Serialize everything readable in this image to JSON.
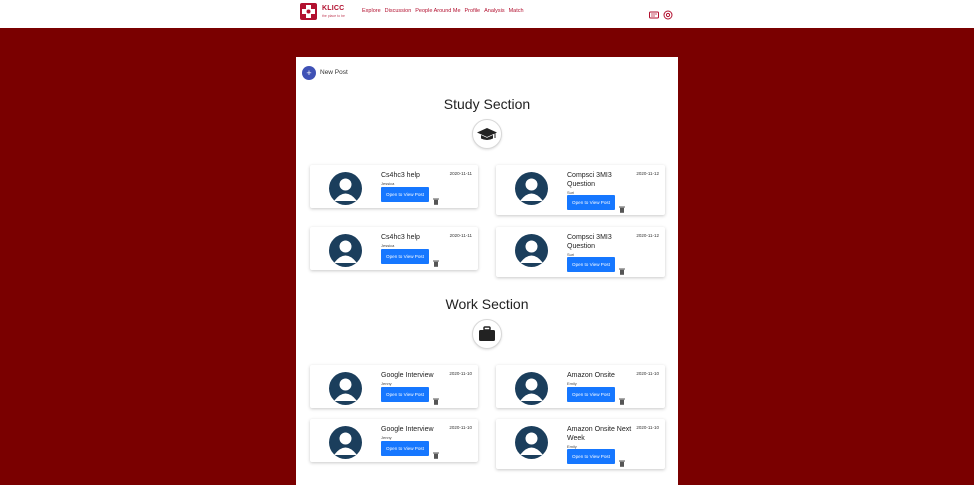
{
  "brand": {
    "name": "KLICC",
    "tagline": "the place to be"
  },
  "nav": [
    "Explore",
    "Discussion",
    "People Around Me",
    "Profile",
    "Analysis",
    "Match"
  ],
  "header_icons": {
    "messages": "message-icon",
    "settings": "settings-icon"
  },
  "new_post": {
    "icon": "+",
    "label": "New Post"
  },
  "sections": [
    {
      "title": "Study Section",
      "icon": "graduation-cap-icon",
      "posts": [
        {
          "title": "Cs4hc3 help",
          "author": "Jessica",
          "date": "2020-11-11",
          "button": "Open to View Post"
        },
        {
          "title": "Compsci 3MI3 Question",
          "author": "Suri",
          "date": "2020-11-12",
          "button": "Open to View Post"
        },
        {
          "title": "Cs4hc3 help",
          "author": "Jessica",
          "date": "2020-11-11",
          "button": "Open to View Post"
        },
        {
          "title": "Compsci 3MI3 Question",
          "author": "Suri",
          "date": "2020-11-12",
          "button": "Open to View Post"
        }
      ]
    },
    {
      "title": "Work Section",
      "icon": "briefcase-icon",
      "posts": [
        {
          "title": "Google Interview",
          "author": "Jenny",
          "date": "2020-11-10",
          "button": "Open to View Post"
        },
        {
          "title": "Amazon Onsite",
          "author": "Emily",
          "date": "2020-11-10",
          "button": "Open to View Post"
        },
        {
          "title": "Google Interview",
          "author": "Jenny",
          "date": "2020-11-10",
          "button": "Open to View Post"
        },
        {
          "title": "Amazon Onsite Next Week",
          "author": "Emily",
          "date": "2020-11-10",
          "button": "Open to View Post"
        }
      ]
    }
  ],
  "colors": {
    "background": "#7a0000",
    "brand": "#b2102f",
    "button": "#1677ff",
    "avatar": "#1b3e5c",
    "fab": "#3f51b5"
  }
}
